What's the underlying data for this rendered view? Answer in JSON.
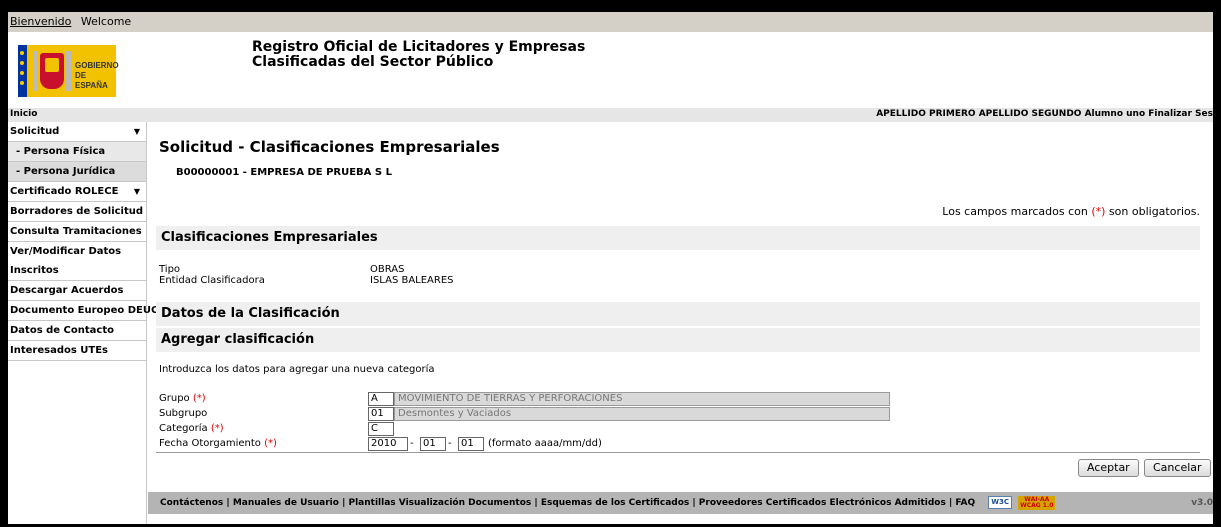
{
  "topbar": {
    "bienvenido": "Bienvenido",
    "welcome": "Welcome"
  },
  "header": {
    "logo_text_1": "GOBIERNO",
    "logo_text_2": "DE ESPAÑA",
    "title_line1": "Registro Oficial de Licitadores y Empresas",
    "title_line2": "Clasificadas del Sector Público"
  },
  "nav": {
    "inicio": "Inicio",
    "user": "APELLIDO PRIMERO APELLIDO SEGUNDO Alumno uno Finalizar Ses"
  },
  "sidebar": {
    "items": [
      {
        "label": "Solicitud",
        "type": "header"
      },
      {
        "label": "- Persona Física",
        "type": "sub"
      },
      {
        "label": "- Persona Jurídica",
        "type": "sub"
      },
      {
        "label": "Certificado ROLECE",
        "type": "header"
      },
      {
        "label": "Borradores de Solicitud"
      },
      {
        "label": "Consulta Tramitaciones"
      },
      {
        "label": "Ver/Modificar Datos Inscritos"
      },
      {
        "label": "Descargar Acuerdos"
      },
      {
        "label": "Documento Europeo DEUC"
      },
      {
        "label": "Datos de Contacto"
      },
      {
        "label": "Interesados UTEs"
      }
    ]
  },
  "main": {
    "title": "Solicitud - Clasificaciones Empresariales",
    "company": "B00000001 - EMPRESA DE PRUEBA S L",
    "required_note_pre": "Los campos marcados con ",
    "required_mark": "(*)",
    "required_note_post": " son obligatorios.",
    "section_clasificaciones": "Clasificaciones Empresariales",
    "tipo_label": "Tipo",
    "tipo_value": "OBRAS",
    "entidad_label": "Entidad Clasificadora",
    "entidad_value": "ISLAS BALEARES",
    "section_datos": "Datos de la Clasificación",
    "section_agregar": "Agregar clasificación",
    "intro": "Introduzca los datos para agregar una nueva categoría"
  },
  "form": {
    "grupo_label": "Grupo",
    "grupo_code": "A",
    "grupo_desc": "MOVIMIENTO DE TIERRAS Y PERFORACIONES",
    "subgrupo_label": "Subgrupo",
    "subgrupo_code": "01",
    "subgrupo_desc": "Desmontes y Vaciados",
    "categoria_label": "Categoría",
    "categoria_code": "C",
    "fecha_label": "Fecha Otorgamiento",
    "fecha_year": "2010",
    "fecha_month": "01",
    "fecha_day": "01",
    "fecha_sep": "-",
    "fecha_format": "(formato aaaa/mm/dd)",
    "req": "(*)",
    "accept_label": "Aceptar",
    "cancel_label": "Cancelar"
  },
  "footer": {
    "links": "Contáctenos | Manuales de Usuario | Plantillas Visualización Documentos | Esquemas de los Certificados  |  Proveedores Certificados Electrónicos Admitidos | FAQ",
    "w3c": "W3C",
    "wai_1": "WAI-AA",
    "wai_2": "WCAG 1.0",
    "version": "v3.0"
  }
}
